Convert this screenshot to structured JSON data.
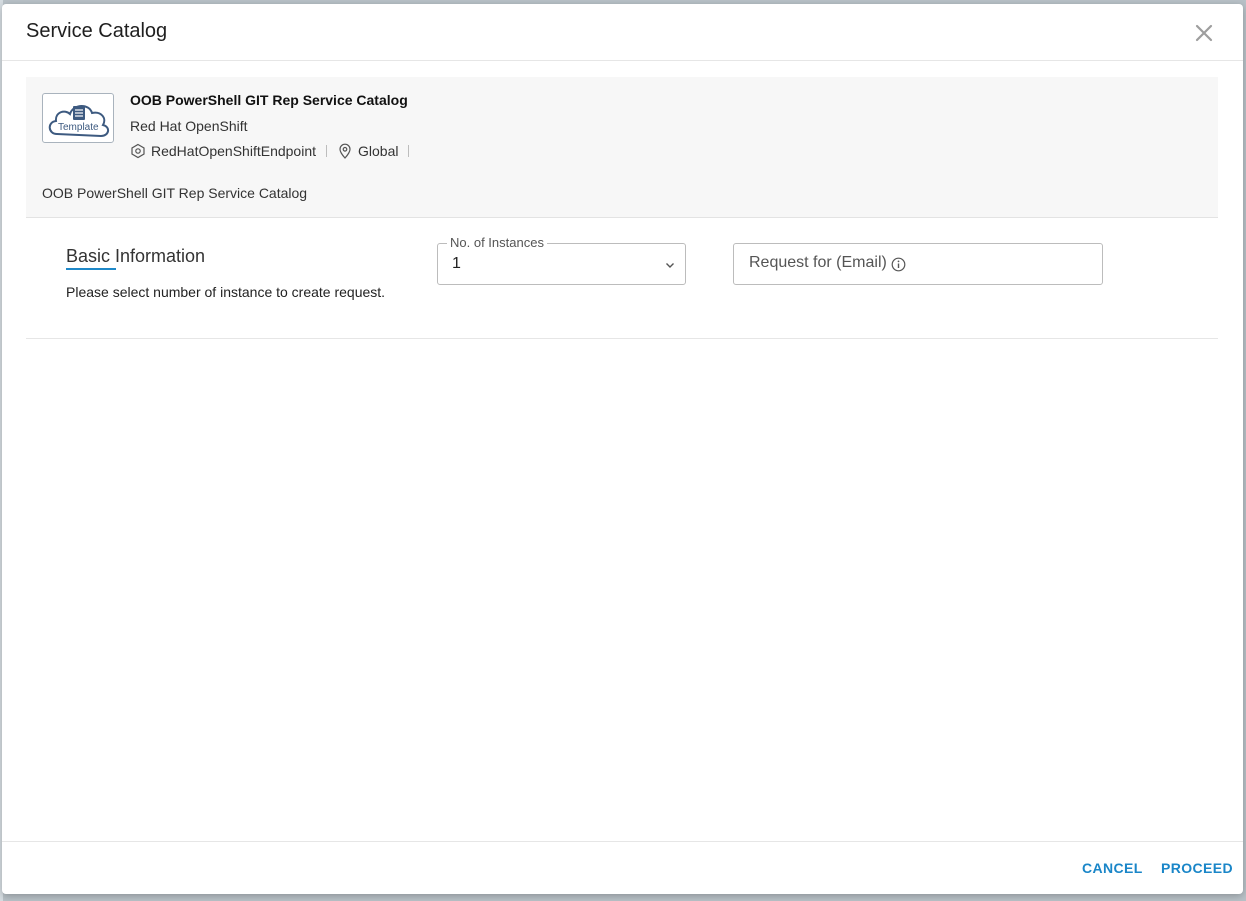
{
  "dialog": {
    "title": "Service Catalog",
    "close_icon": "close-icon"
  },
  "summary": {
    "template_label": "Template",
    "service_name": "OOB PowerShell GIT Rep Service Catalog",
    "provider": "Red Hat OpenShift",
    "endpoint": "RedHatOpenShiftEndpoint",
    "region": "Global",
    "description": "OOB PowerShell GIT Rep Service Catalog"
  },
  "basic_info": {
    "title": "Basic Information",
    "hint": "Please select number of instance to create request.",
    "instances_label": "No. of Instances",
    "instances_value": "1",
    "email_placeholder": "Request for (Email)"
  },
  "footer": {
    "cancel_label": "CANCEL",
    "proceed_label": "PROCEED"
  },
  "colors": {
    "accent": "#1a86c8",
    "summary_bg": "#f7f7f7"
  }
}
